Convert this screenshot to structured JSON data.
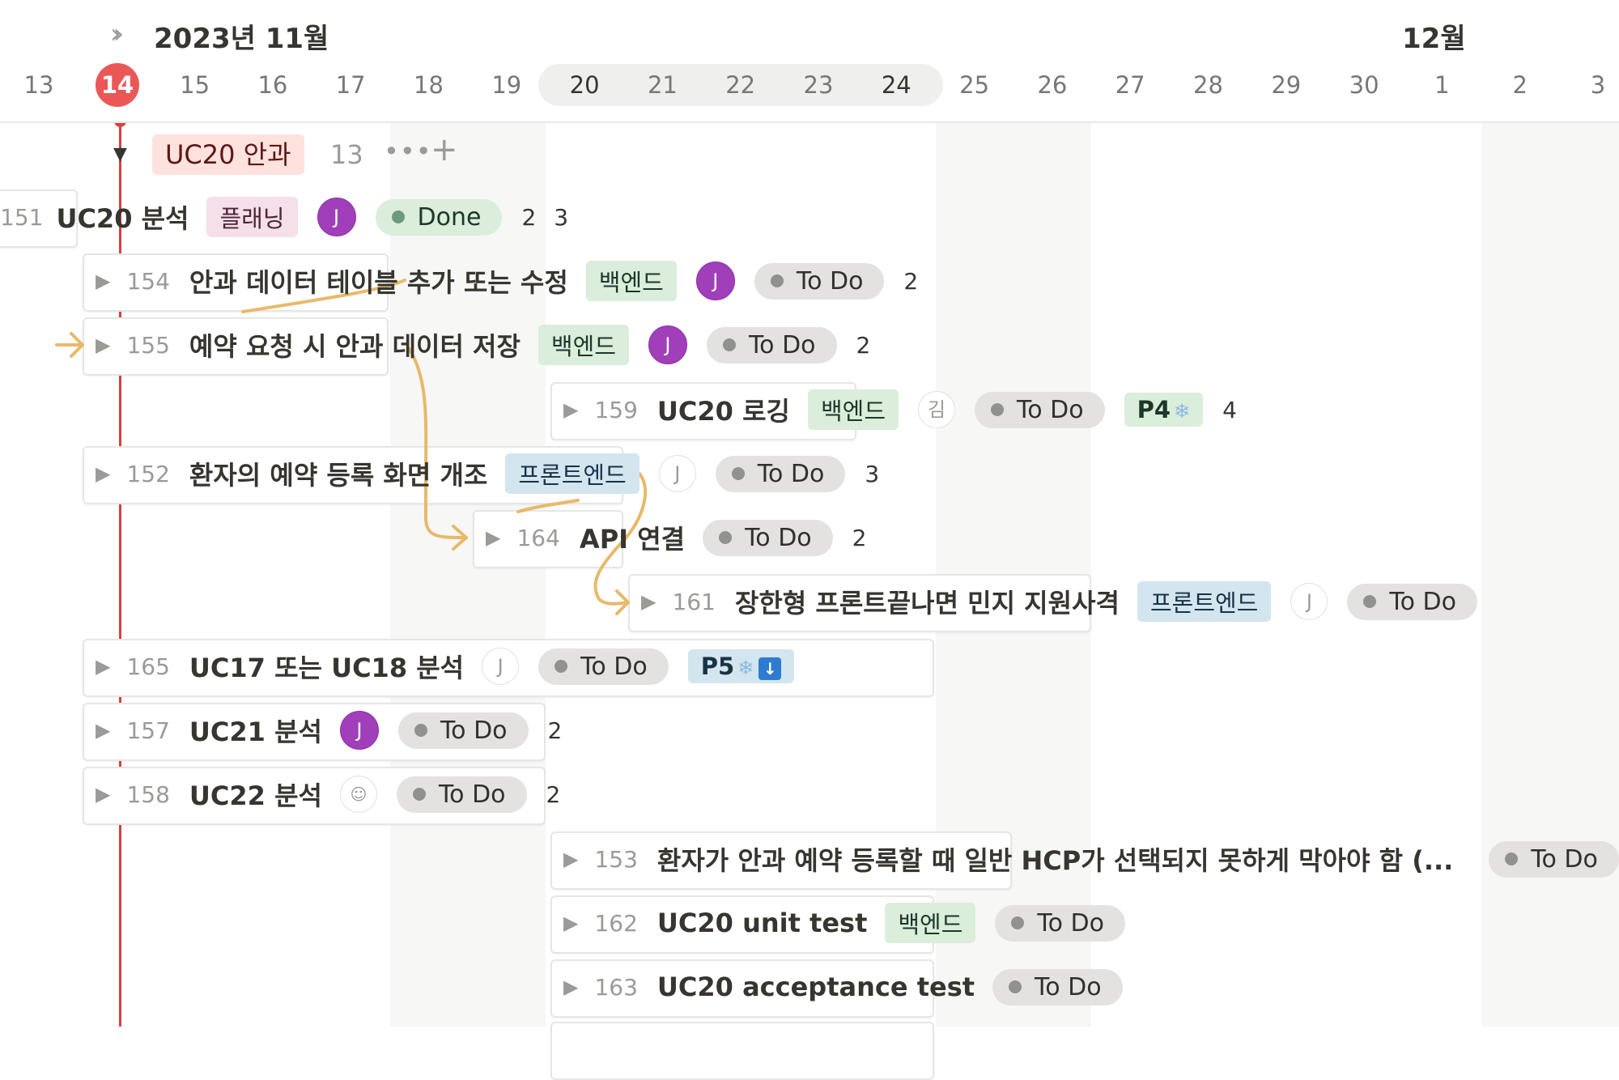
{
  "timeline": {
    "month_current": "2023년 11월",
    "month_next": "12월",
    "days": [
      "13",
      "14",
      "15",
      "16",
      "17",
      "18",
      "19",
      "20",
      "21",
      "22",
      "23",
      "24",
      "25",
      "26",
      "27",
      "28",
      "29",
      "30",
      "1",
      "2",
      "3"
    ],
    "today": "14"
  },
  "group": {
    "name": "UC20 안과",
    "count": "13",
    "more": "•••",
    "add": "+"
  },
  "tasks": [
    {
      "id": "151",
      "name": "UC20 분석",
      "tag": "플래닝",
      "avatar": "J",
      "status": "Done",
      "n1": "2",
      "n2": "3"
    },
    {
      "id": "154",
      "name": "안과 데이터 테이블 추가 또는 수정",
      "tag": "백엔드",
      "avatar": "J",
      "status": "To Do",
      "n1": "2"
    },
    {
      "id": "155",
      "name": "예약 요청 시 안과 데이터 저장",
      "tag": "백엔드",
      "avatar": "J",
      "status": "To Do",
      "n1": "2"
    },
    {
      "id": "159",
      "name": "UC20 로깅",
      "tag": "백엔드",
      "avatar": "김",
      "status": "To Do",
      "priority": "P4",
      "n1": "4"
    },
    {
      "id": "152",
      "name": "환자의 예약 등록 화면 개조",
      "tag": "프론트엔드",
      "avatar": "J",
      "status": "To Do",
      "n1": "3"
    },
    {
      "id": "164",
      "name": "API 연결",
      "status": "To Do",
      "n1": "2"
    },
    {
      "id": "161",
      "name": "장한형 프론트끝나면 민지 지원사격",
      "tag": "프론트엔드",
      "avatar": "J",
      "status": "To Do"
    },
    {
      "id": "165",
      "name": "UC17 또는 UC18 분석",
      "avatar": "J",
      "status": "To Do",
      "priority": "P5"
    },
    {
      "id": "157",
      "name": "UC21 분석",
      "avatar": "J",
      "status": "To Do",
      "n1": "2"
    },
    {
      "id": "158",
      "name": "UC22 분석",
      "status": "To Do",
      "n1": "2"
    },
    {
      "id": "153",
      "name": "환자가 안과 예약 등록할 때 일반 HCP가 선택되지 못하게 막아야 함 (...",
      "status": "To Do"
    },
    {
      "id": "162",
      "name": "UC20 unit test",
      "tag": "백엔드",
      "status": "To Do"
    },
    {
      "id": "163",
      "name": "UC20 acceptance test",
      "status": "To Do"
    }
  ],
  "icons": {
    "expand": "chevron-double-right-icon",
    "row_toggle": "triangle-right-icon",
    "snowflake": "snowflake-icon",
    "down_arrow": "arrow-down-icon"
  },
  "colors": {
    "today": "#eb5757",
    "dependency": "#e8b96a",
    "avatar": "#a13fba"
  }
}
